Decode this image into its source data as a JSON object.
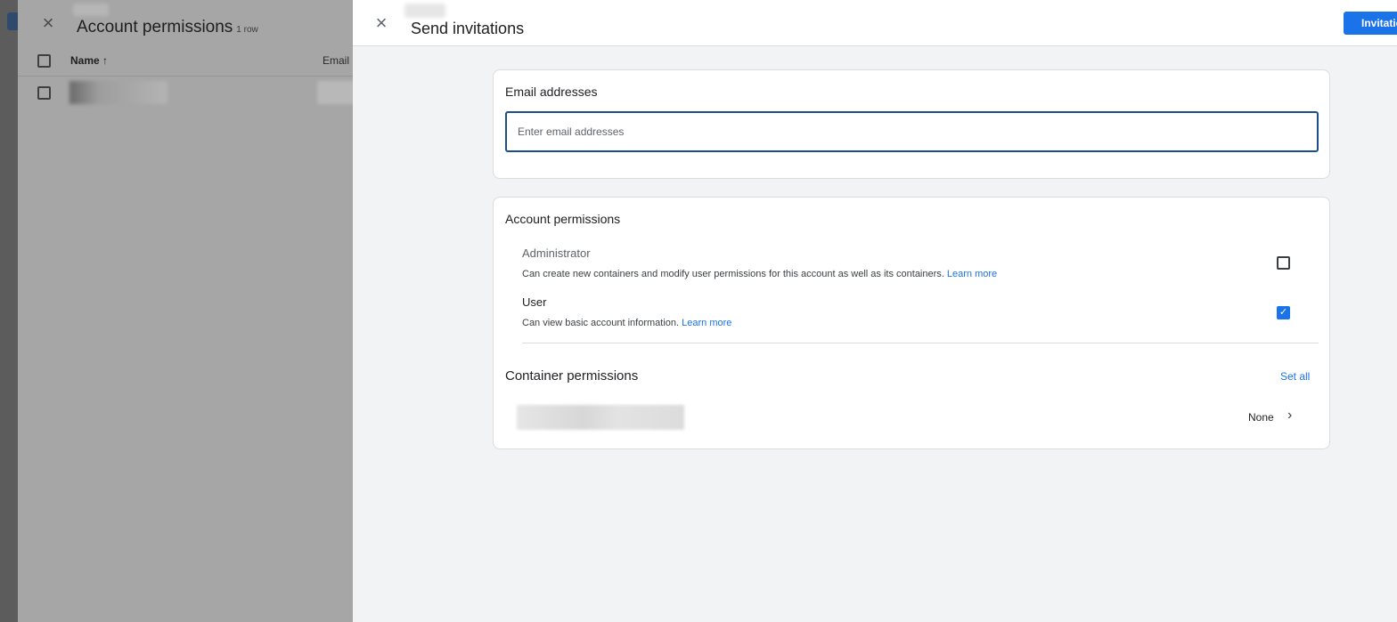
{
  "background_panel": {
    "title": "Account permissions",
    "row_count": "1 row",
    "columns": [
      "Name",
      "Email"
    ],
    "sort_indicator": "↑",
    "close_icon": "×"
  },
  "drawer": {
    "title": "Send invitations",
    "close_icon": "×",
    "send_button": "Invitations"
  },
  "email_section": {
    "title": "Email addresses",
    "placeholder": "Enter email addresses",
    "value": ""
  },
  "account_permissions": {
    "title": "Account permissions",
    "roles": [
      {
        "title": "Administrator",
        "description": "Can create new containers and modify user permissions for this account as well as its containers.",
        "link": "Learn more",
        "checked": false
      },
      {
        "title": "User",
        "description": "Can view basic account information.",
        "link": "Learn more",
        "checked": true
      }
    ]
  },
  "container_permissions": {
    "title": "Container permissions",
    "set_all_label": "Set all",
    "rows": [
      {
        "value": "None"
      }
    ]
  },
  "colors": {
    "accent": "#1a73e8",
    "input_border": "#1a4f8b",
    "drawer_bg": "#f1f3f4"
  }
}
